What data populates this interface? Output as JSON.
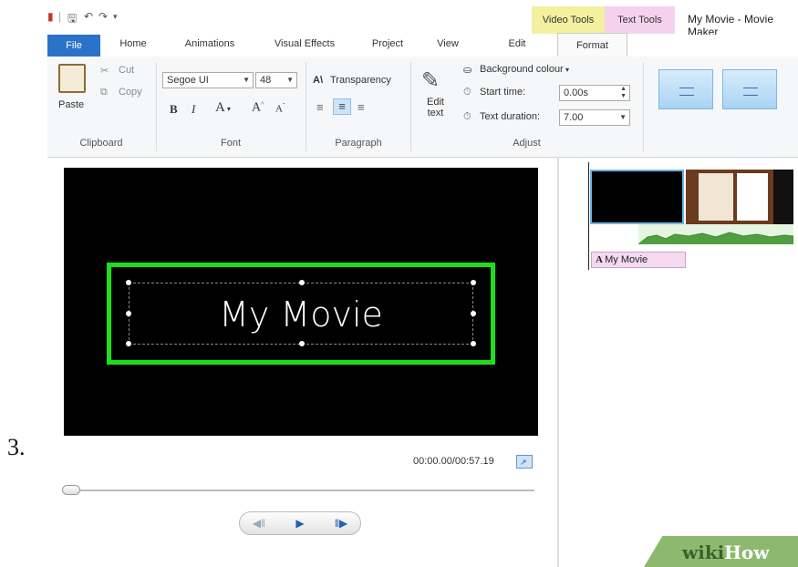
{
  "step_number": "3.",
  "window": {
    "title": "My Movie - Movie Maker",
    "context_tabs": {
      "video_tools": "Video Tools",
      "text_tools": "Text Tools"
    }
  },
  "tabs": [
    "File",
    "Home",
    "Animations",
    "Visual Effects",
    "Project",
    "View",
    "Edit",
    "Format"
  ],
  "active_tab": "Format",
  "ribbon": {
    "clipboard": {
      "paste": "Paste",
      "cut": "Cut",
      "copy": "Copy",
      "label": "Clipboard"
    },
    "font": {
      "family": "Segoe UI",
      "size": "48",
      "bold": "B",
      "italic": "I",
      "color": "A",
      "grow": "A",
      "shrink": "A",
      "label": "Font"
    },
    "paragraph": {
      "transparency": "Transparency",
      "label": "Paragraph"
    },
    "adjust": {
      "edit_text_line1": "Edit",
      "edit_text_line2": "text",
      "background_colour": "Background colour",
      "start_time_label": "Start time:",
      "start_time_value": "0.00s",
      "text_duration_label": "Text duration:",
      "text_duration_value": "7.00",
      "label": "Adjust"
    }
  },
  "preview": {
    "caption_text": "My Movie",
    "time": "00:00.00/00:57.19",
    "seek_progress": 0
  },
  "storyboard": {
    "caption_clip": "My Movie"
  },
  "watermark": {
    "part1": "wiki",
    "part2": "How"
  },
  "colors": {
    "file_tab": "#2b73c8",
    "video_tools": "#f3f0a0",
    "text_tools": "#f4d2ee",
    "text_box_border": "#1ae01a"
  }
}
